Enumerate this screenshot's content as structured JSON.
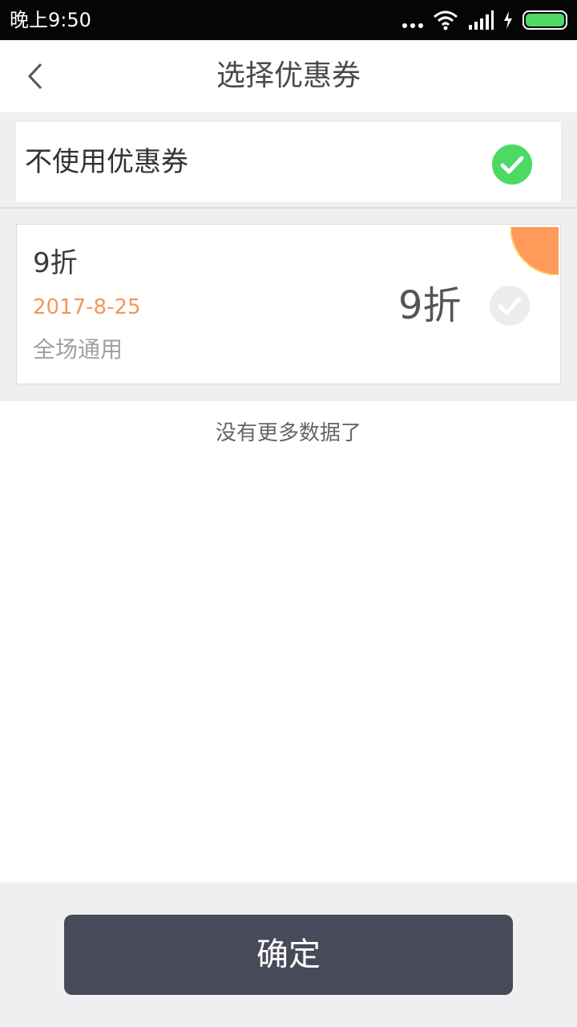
{
  "status_bar": {
    "time": "晚上9:50",
    "icons": [
      "more-dots-icon",
      "wifi-icon",
      "signal-icon",
      "charging-icon",
      "battery-icon"
    ]
  },
  "header": {
    "title": "选择优惠券",
    "back_icon": "chevron-left-icon"
  },
  "no_coupon_option": {
    "label": "不使用优惠券",
    "selected": true
  },
  "coupons": [
    {
      "name": "9折",
      "date": "2017-8-25",
      "scope": "全场通用",
      "value": "9折",
      "selected": false
    }
  ],
  "list_end_text": "没有更多数据了",
  "confirm_label": "确定",
  "colors": {
    "accent_green": "#4cd964",
    "date_orange": "#f4965a",
    "corner_orange": "#ff9a5a",
    "button_dark": "#494a59",
    "background_gray": "#efeff1"
  }
}
